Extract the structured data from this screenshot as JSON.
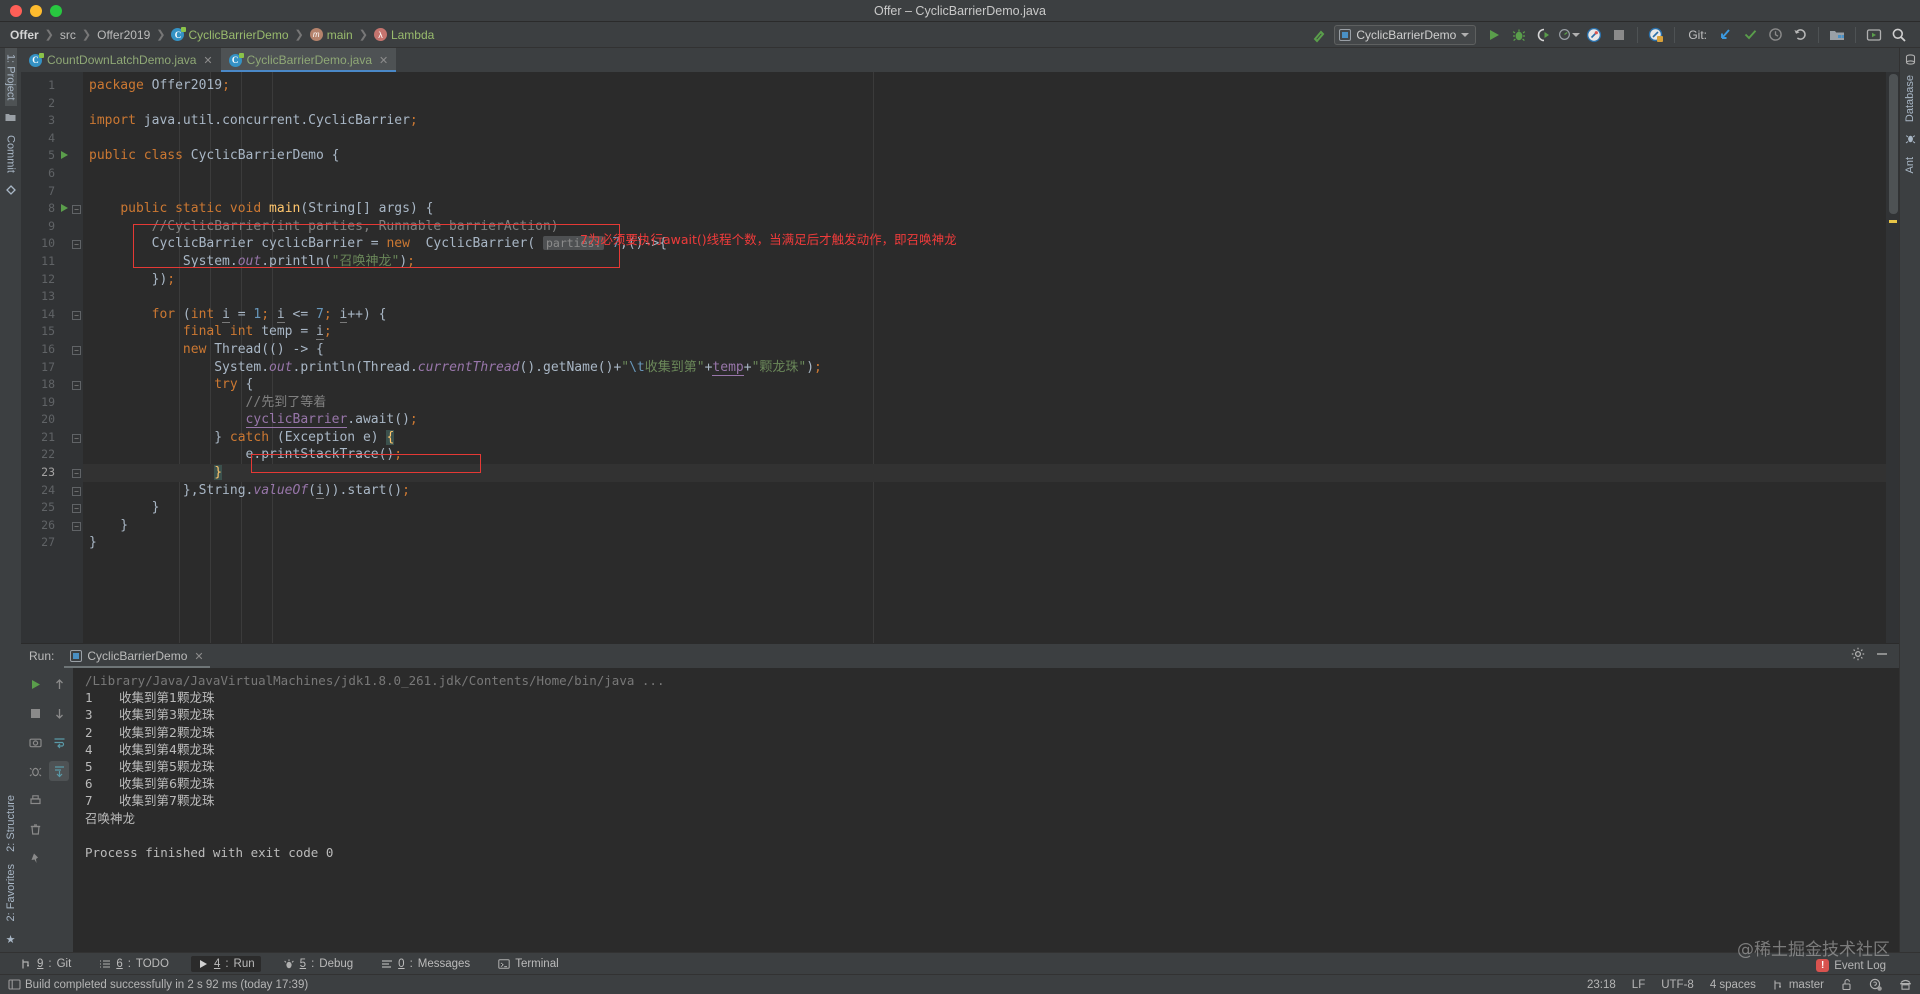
{
  "window": {
    "title": "Offer – CyclicBarrierDemo.java"
  },
  "breadcrumb": [
    {
      "label": "Offer",
      "icon": "none"
    },
    {
      "label": "src",
      "icon": "none"
    },
    {
      "label": "Offer2019",
      "icon": "none"
    },
    {
      "label": "CyclicBarrierDemo",
      "icon": "class-icon"
    },
    {
      "label": "main",
      "icon": "method-icon"
    },
    {
      "label": "Lambda",
      "icon": "lambda-icon"
    }
  ],
  "toolbar": {
    "build_hammer": "build-icon",
    "run_config": "CyclicBarrierDemo",
    "run": "run-icon",
    "debug": "debug-icon",
    "run_coverage": "run-with-coverage-icon",
    "profiler": "profiler-icon",
    "stop": "stop-icon",
    "attach": "attach-profiler-icon",
    "git_label": "Git:",
    "git_update": "update-project-icon",
    "git_commit": "commit-icon",
    "git_history": "history-icon",
    "git_rollback": "rollback-icon",
    "project_structure": "project-structure-icon",
    "select_target": "select-target-icon",
    "search": "search-everywhere-icon"
  },
  "left_rail": [
    {
      "label": "1: Project",
      "selected": true
    },
    {
      "label": "Commit",
      "selected": false
    },
    {
      "label": "2: Structure",
      "selected": false
    },
    {
      "label": "2: Favorites",
      "selected": false
    }
  ],
  "right_rail": [
    {
      "label": "Database"
    },
    {
      "label": "Ant"
    }
  ],
  "editor_tabs": [
    {
      "label": "CountDownLatchDemo.java",
      "active": false
    },
    {
      "label": "CyclicBarrierDemo.java",
      "active": true
    }
  ],
  "editor": {
    "current_line": 23,
    "gutter_run_lines": [
      5,
      8
    ],
    "total_lines": 27,
    "annotation": "7为必须要执行await()线程个数，当满足后才触发动作，即召唤神龙",
    "parameter_hint": "parties:",
    "lines": [
      {
        "n": 1,
        "text": "package Offer2019;"
      },
      {
        "n": 2,
        "text": ""
      },
      {
        "n": 3,
        "text": "import java.util.concurrent.CyclicBarrier;"
      },
      {
        "n": 4,
        "text": ""
      },
      {
        "n": 5,
        "text": "public class CyclicBarrierDemo {"
      },
      {
        "n": 6,
        "text": ""
      },
      {
        "n": 7,
        "text": ""
      },
      {
        "n": 8,
        "text": "    public static void main(String[] args) {"
      },
      {
        "n": 9,
        "text": "        //CyclicBarrier(int parties, Runnable barrierAction)"
      },
      {
        "n": 10,
        "text": "        CyclicBarrier cyclicBarrier = new  CyclicBarrier( parties: 7,()->{"
      },
      {
        "n": 11,
        "text": "            System.out.println(\"召唤神龙\");"
      },
      {
        "n": 12,
        "text": "        });"
      },
      {
        "n": 13,
        "text": ""
      },
      {
        "n": 14,
        "text": "        for (int i = 1; i <= 7; i++) {"
      },
      {
        "n": 15,
        "text": "            final int temp = i;"
      },
      {
        "n": 16,
        "text": "            new Thread(() -> {"
      },
      {
        "n": 17,
        "text": "                System.out.println(Thread.currentThread().getName()+\"\\t收集到第\"+temp+\"颗龙珠\");"
      },
      {
        "n": 18,
        "text": "                try {"
      },
      {
        "n": 19,
        "text": "                    //先到了等着"
      },
      {
        "n": 20,
        "text": "                    cyclicBarrier.await();"
      },
      {
        "n": 21,
        "text": "                } catch (Exception e) {"
      },
      {
        "n": 22,
        "text": "                    e.printStackTrace();"
      },
      {
        "n": 23,
        "text": "                }"
      },
      {
        "n": 24,
        "text": "            },String.valueOf(i)).start();"
      },
      {
        "n": 25,
        "text": "        }"
      },
      {
        "n": 26,
        "text": "    }"
      },
      {
        "n": 27,
        "text": "}"
      }
    ]
  },
  "run_window": {
    "label": "Run:",
    "tab": "CyclicBarrierDemo",
    "console": [
      {
        "kind": "cmd",
        "text": "/Library/Java/JavaVirtualMachines/jdk1.8.0_261.jdk/Contents/Home/bin/java ..."
      },
      {
        "kind": "out",
        "tid": "1",
        "text": "收集到第1颗龙珠"
      },
      {
        "kind": "out",
        "tid": "3",
        "text": "收集到第3颗龙珠"
      },
      {
        "kind": "out",
        "tid": "2",
        "text": "收集到第2颗龙珠"
      },
      {
        "kind": "out",
        "tid": "4",
        "text": "收集到第4颗龙珠"
      },
      {
        "kind": "out",
        "tid": "5",
        "text": "收集到第5颗龙珠"
      },
      {
        "kind": "out",
        "tid": "6",
        "text": "收集到第6颗龙珠"
      },
      {
        "kind": "out",
        "tid": "7",
        "text": "收集到第7颗龙珠"
      },
      {
        "kind": "plain",
        "text": "召唤神龙"
      },
      {
        "kind": "blank",
        "text": ""
      },
      {
        "kind": "exit",
        "text": "Process finished with exit code 0"
      }
    ]
  },
  "tool_windows": [
    {
      "num": "9",
      "label": "Git",
      "icon": "git-icon",
      "active": false
    },
    {
      "num": "6",
      "label": "TODO",
      "icon": "todo-icon",
      "active": false
    },
    {
      "num": "4",
      "label": "Run",
      "icon": "run-icon",
      "active": true
    },
    {
      "num": "5",
      "label": "Debug",
      "icon": "debug-icon",
      "active": false
    },
    {
      "num": "0",
      "label": "Messages",
      "icon": "messages-icon",
      "active": false
    },
    {
      "num": "",
      "label": "Terminal",
      "icon": "terminal-icon",
      "active": false
    }
  ],
  "status_bar": {
    "message": "Build completed successfully in 2 s 92 ms (today 17:39)",
    "time": "23:18",
    "line_sep": "LF",
    "encoding": "UTF-8",
    "indent": "4 spaces",
    "branch": "master",
    "event_log": "Event Log"
  },
  "watermark": "@稀土掘金技术社区",
  "colors": {
    "bg_chrome": "#3c3f41",
    "bg_editor": "#2b2b2b",
    "accent_blue": "#4a88c7",
    "annotation_red": "#f03b3b",
    "keyword_orange": "#cc7832",
    "string_green": "#6a8759",
    "number_blue": "#6897bb",
    "field_purple": "#9876aa",
    "method_yellow": "#ffc66d",
    "comment_gray": "#808080"
  }
}
